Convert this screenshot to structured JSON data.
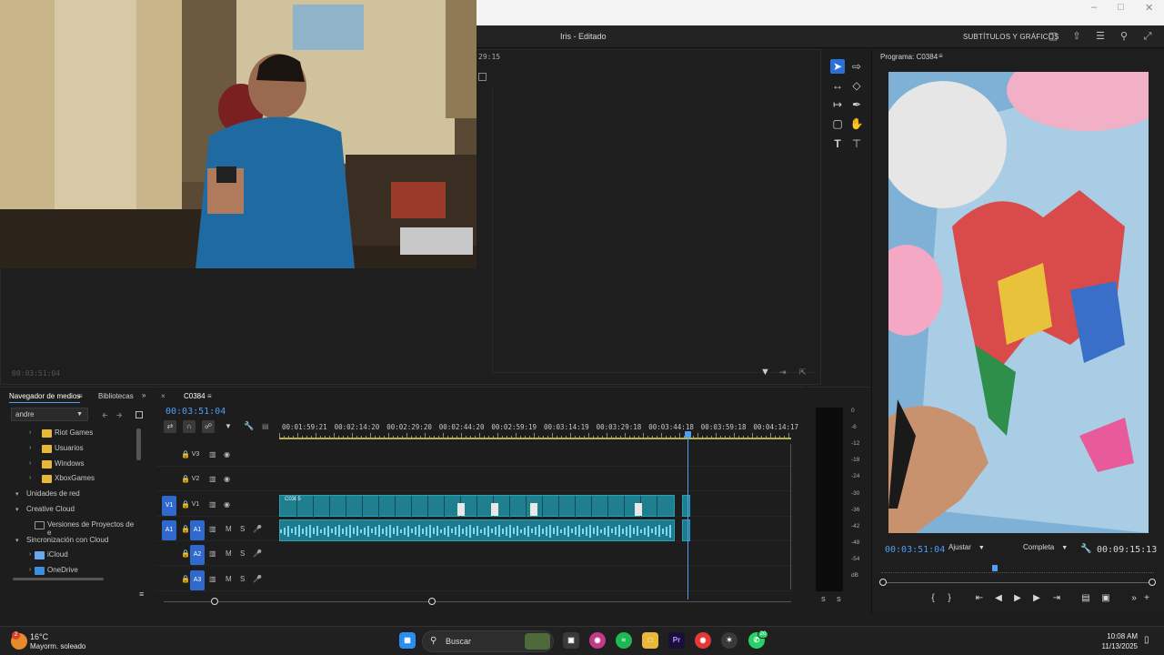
{
  "app": {
    "document_title": "Iris - Editado",
    "workspace_label": "SUBTÍTULOS Y GRÁFICOS"
  },
  "source_monitor": {
    "top_timecode": "29:15",
    "bottom_timecode": "00:03:51:04"
  },
  "program_monitor": {
    "title": "Programa: C0384",
    "current_timecode": "00:03:51:04",
    "fit_select": "Ajustar",
    "quality_select": "Completa",
    "duration": "00:09:15:13"
  },
  "media_browser": {
    "tab_media": "Navegador de medios",
    "tab_libraries": "Bibliotecas",
    "path_dropdown": "andre",
    "tree": [
      {
        "label": "Riot Games",
        "depth": 2,
        "type": "folder",
        "expanded": false
      },
      {
        "label": "Usuarios",
        "depth": 2,
        "type": "folder",
        "expanded": false
      },
      {
        "label": "Windows",
        "depth": 2,
        "type": "folder",
        "expanded": false
      },
      {
        "label": "XboxGames",
        "depth": 2,
        "type": "folder",
        "expanded": false
      },
      {
        "label": "Unidades de red",
        "depth": 1,
        "type": "group",
        "expanded": true
      },
      {
        "label": "Creative Cloud",
        "depth": 1,
        "type": "group",
        "expanded": true
      },
      {
        "label": "Versiones de Proyectos de e",
        "depth": 2,
        "type": "item",
        "expanded": false
      },
      {
        "label": "Sincronización con Cloud",
        "depth": 1,
        "type": "group",
        "expanded": true
      },
      {
        "label": "iCloud",
        "depth": 2,
        "type": "cloud",
        "expanded": false
      },
      {
        "label": "OneDrive",
        "depth": 2,
        "type": "cloud",
        "expanded": false
      }
    ]
  },
  "timeline": {
    "sequence_tab": "C0384",
    "current_timecode": "00:03:51:04",
    "ruler_labels": [
      "00:01:59:21",
      "00:02:14:20",
      "00:02:29:20",
      "00:02:44:20",
      "00:02:59:19",
      "00:03:14:19",
      "00:03:29:18",
      "00:03:44:18",
      "00:03:59:18",
      "00:04:14:17"
    ],
    "clip_name": "C0385",
    "tracks": [
      {
        "name": "V3",
        "source": "",
        "mute": "",
        "solo": ""
      },
      {
        "name": "V2",
        "source": "",
        "mute": "",
        "solo": ""
      },
      {
        "name": "V1",
        "source": "V1",
        "mute": "",
        "solo": ""
      },
      {
        "name": "A1",
        "source": "A1",
        "mute": "M",
        "solo": "S"
      },
      {
        "name": "A2",
        "source": "",
        "mute": "M",
        "solo": "S"
      },
      {
        "name": "A3",
        "source": "",
        "mute": "M",
        "solo": "S"
      }
    ]
  },
  "audio_meter": {
    "scale": [
      "0",
      "-6",
      "-12",
      "-18",
      "-24",
      "-30",
      "-36",
      "-42",
      "-48",
      "-54",
      "dB"
    ],
    "solo_left": "S",
    "solo_right": "S"
  },
  "taskbar": {
    "weather_badge": "2",
    "temperature": "16°C",
    "weather_text": "Mayorm. soleado",
    "search_placeholder": "Buscar",
    "whatsapp_badge": "20",
    "time": "10:08 AM",
    "date": "11/13/2025"
  },
  "colors": {
    "accent_blue": "#4f9ef3",
    "track_target_blue": "#2f68cf",
    "clip_teal": "#1f7f8f",
    "ruler_yellow": "#b9b24a"
  }
}
